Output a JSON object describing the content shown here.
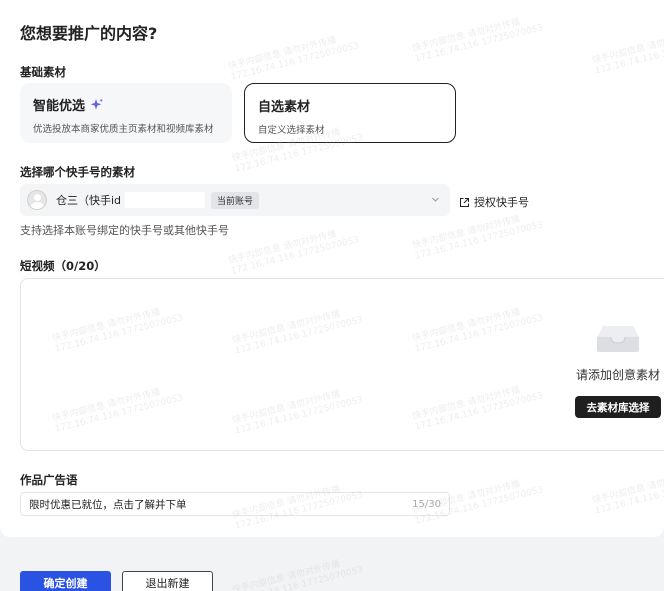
{
  "page": {
    "title": "您想要推广的内容?"
  },
  "sections": {
    "base_material": "基础素材",
    "choose_account": "选择哪个快手号的素材",
    "short_video": "短视频（0/20）",
    "ad_copy": "作品广告语"
  },
  "material_options": [
    {
      "title": "智能优选",
      "desc": "优选投放本商家优质主页素材和视频库素材",
      "icon": "sparkle-icon"
    },
    {
      "title": "自选素材",
      "desc": "自定义选择素材"
    }
  ],
  "account": {
    "name": "仓三（快手id",
    "badge": "当前账号",
    "authorize_label": "授权快手号",
    "hint": "支持选择本账号绑定的快手号或其他快手号"
  },
  "video": {
    "empty_text": "请添加创意素材",
    "library_button": "去素材库选择",
    "icon": "inbox-icon"
  },
  "ad_copy": {
    "value": "限时优惠已就位，点击了解并下单",
    "count": "15/30"
  },
  "footer": {
    "confirm": "确定创建",
    "exit": "退出新建"
  },
  "watermark": {
    "line1": "快手内部信息 请勿对外传播",
    "line2": "172.16.74.116 17725070053"
  },
  "colors": {
    "primary": "#2b53e3",
    "dark_button": "#1f1f1f",
    "sparkle": "#5b5ff3"
  }
}
